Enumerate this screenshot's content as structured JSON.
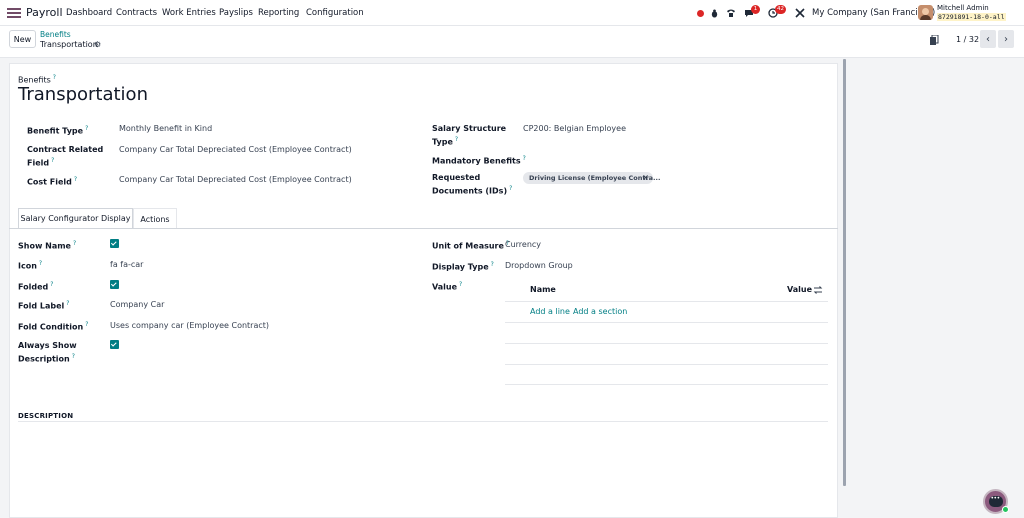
{
  "navbar": {
    "app_name": "Payroll",
    "menu": [
      "Dashboard",
      "Contracts",
      "Work Entries",
      "Payslips",
      "Reporting",
      "Configuration"
    ],
    "messages_badge": "1",
    "activities_badge": "42",
    "company": "My Company (San Francisco)",
    "user_name": "Mitchell Admin",
    "db_name": "87291891-18-0-all",
    "icons": [
      "record-dot-icon",
      "bug-icon",
      "phone-icon",
      "chat-icon",
      "clock-icon",
      "tools-icon",
      "apps-grid-icon"
    ]
  },
  "control": {
    "new_label": "New",
    "breadcrumb_parent": "Benefits",
    "breadcrumb_current": "Transportation",
    "pager": "1 / 32"
  },
  "form": {
    "header_label": "Benefits",
    "title": "Transportation",
    "left_fields": {
      "benefit_type_label": "Benefit Type",
      "benefit_type_value": "Monthly Benefit in Kind",
      "contract_field_label": "Contract Related Field",
      "contract_field_value": "Company Car Total Depreciated Cost (Employee Contract)",
      "cost_field_label": "Cost Field",
      "cost_field_value": "Company Car Total Depreciated Cost (Employee Contract)"
    },
    "right_fields": {
      "structure_label": "Salary Structure Type",
      "structure_value": "CP200: Belgian Employee",
      "mandatory_label": "Mandatory Benefits",
      "docs_label": "Requested Documents (IDs)",
      "docs_tag": "Driving License (Employee Contra..."
    },
    "tabs": [
      "Salary Configurator Display",
      "Actions"
    ],
    "configurator": {
      "show_name_label": "Show Name",
      "icon_label": "Icon",
      "icon_value": "fa fa-car",
      "folded_label": "Folded",
      "fold_label_label": "Fold Label",
      "fold_label_value": "Company Car",
      "fold_condition_label": "Fold Condition",
      "fold_condition_value": "Uses company car (Employee Contract)",
      "always_show_label": "Always Show Description",
      "uom_label": "Unit of Measure",
      "uom_value": "Currency",
      "display_type_label": "Display Type",
      "display_type_value": "Dropdown Group",
      "value_label": "Value",
      "table_headers": [
        "Name",
        "Value"
      ],
      "add_line": "Add a line",
      "add_section": "Add a section"
    },
    "description_title": "DESCRIPTION"
  },
  "colors": {
    "accent": "#017e84",
    "brand": "#714B67",
    "badge": "#dc2626"
  }
}
